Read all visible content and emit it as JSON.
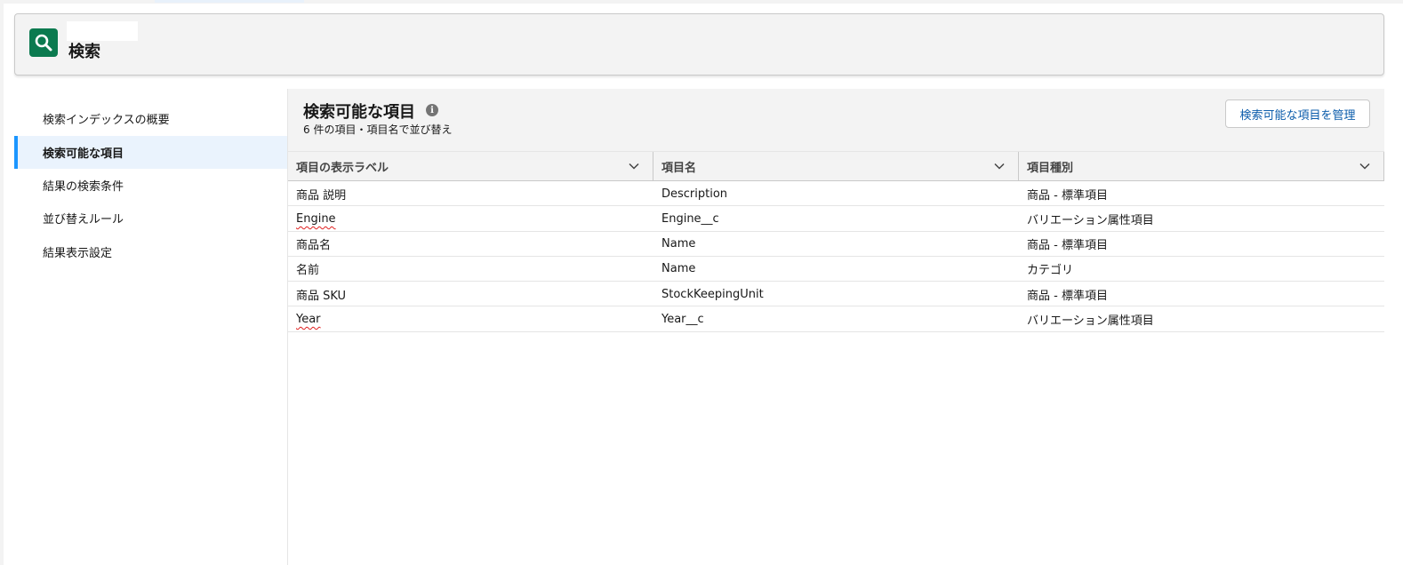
{
  "header": {
    "title": "検索",
    "icon": "search-icon",
    "icon_color": "#0b7a4f"
  },
  "sidebar": {
    "items": [
      {
        "label": "検索インデックスの概要",
        "active": false
      },
      {
        "label": "検索可能な項目",
        "active": true
      },
      {
        "label": "結果の検索条件",
        "active": false
      },
      {
        "label": "並び替えルール",
        "active": false
      },
      {
        "label": "結果表示設定",
        "active": false
      }
    ],
    "accent_color": "#1b96ff"
  },
  "main": {
    "title": "検索可能な項目",
    "info_icon": "info-icon",
    "subtitle": "6 件の項目・項目名で並び替え",
    "manage_button": "検索可能な項目を管理",
    "button_text_color": "#0b5cab",
    "table": {
      "columns": [
        "項目の表示ラベル",
        "項目名",
        "項目種別"
      ],
      "rows": [
        [
          "商品 説明",
          "Description",
          "商品 - 標準項目"
        ],
        [
          "Engine",
          "Engine__c",
          "バリエーション属性項目"
        ],
        [
          "商品名",
          "Name",
          "商品 - 標準項目"
        ],
        [
          "名前",
          "Name",
          "カテゴリ"
        ],
        [
          "商品 SKU",
          "StockKeepingUnit",
          "商品 - 標準項目"
        ],
        [
          "Year",
          "Year__c",
          "バリエーション属性項目"
        ]
      ]
    }
  }
}
